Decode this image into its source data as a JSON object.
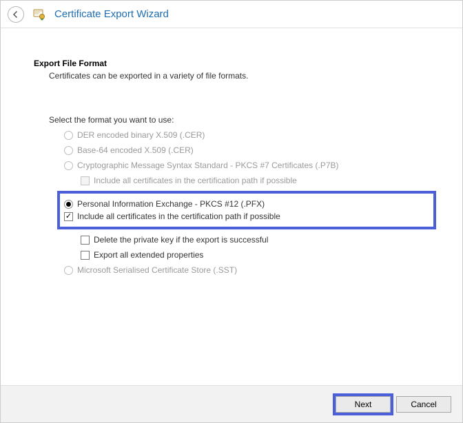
{
  "title": "Certificate Export Wizard",
  "heading": "Export File Format",
  "subheading": "Certificates can be exported in a variety of file formats.",
  "prompt": "Select the format you want to use:",
  "options": {
    "der": "DER encoded binary X.509 (.CER)",
    "base64": "Base-64 encoded X.509 (.CER)",
    "p7b": "Cryptographic Message Syntax Standard - PKCS #7 Certificates (.P7B)",
    "p7b_include": "Include all certificates in the certification path if possible",
    "pfx": "Personal Information Exchange - PKCS #12 (.PFX)",
    "pfx_include": "Include all certificates in the certification path if possible",
    "pfx_delete": "Delete the private key if the export is successful",
    "pfx_extprops": "Export all extended properties",
    "sst": "Microsoft Serialised Certificate Store (.SST)"
  },
  "buttons": {
    "next": "Next",
    "cancel": "Cancel"
  }
}
